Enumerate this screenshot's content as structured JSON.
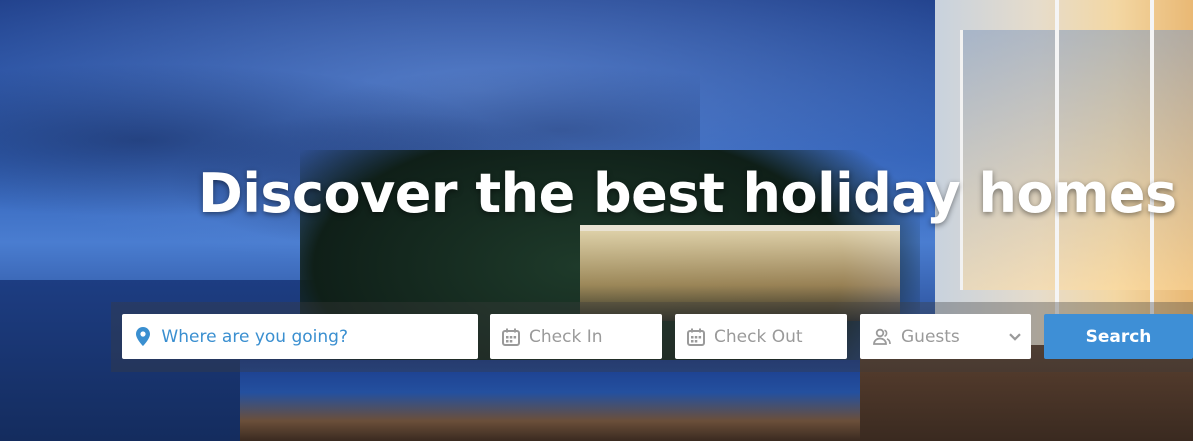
{
  "hero": {
    "headline": "Discover the best holiday homes"
  },
  "search": {
    "destination": {
      "placeholder": "Where are you going?",
      "icon": "map-pin-icon"
    },
    "check_in": {
      "placeholder": "Check In",
      "icon": "calendar-icon"
    },
    "check_out": {
      "placeholder": "Check Out",
      "icon": "calendar-icon"
    },
    "guests": {
      "label": "Guests",
      "icon": "users-icon",
      "dropdown_icon": "chevron-down-icon"
    },
    "button_label": "Search"
  },
  "colors": {
    "accent": "#3e8fd6",
    "placeholder_accent": "#3a8fd0",
    "placeholder_muted": "#9a9a9a",
    "headline": "#ffffff"
  }
}
